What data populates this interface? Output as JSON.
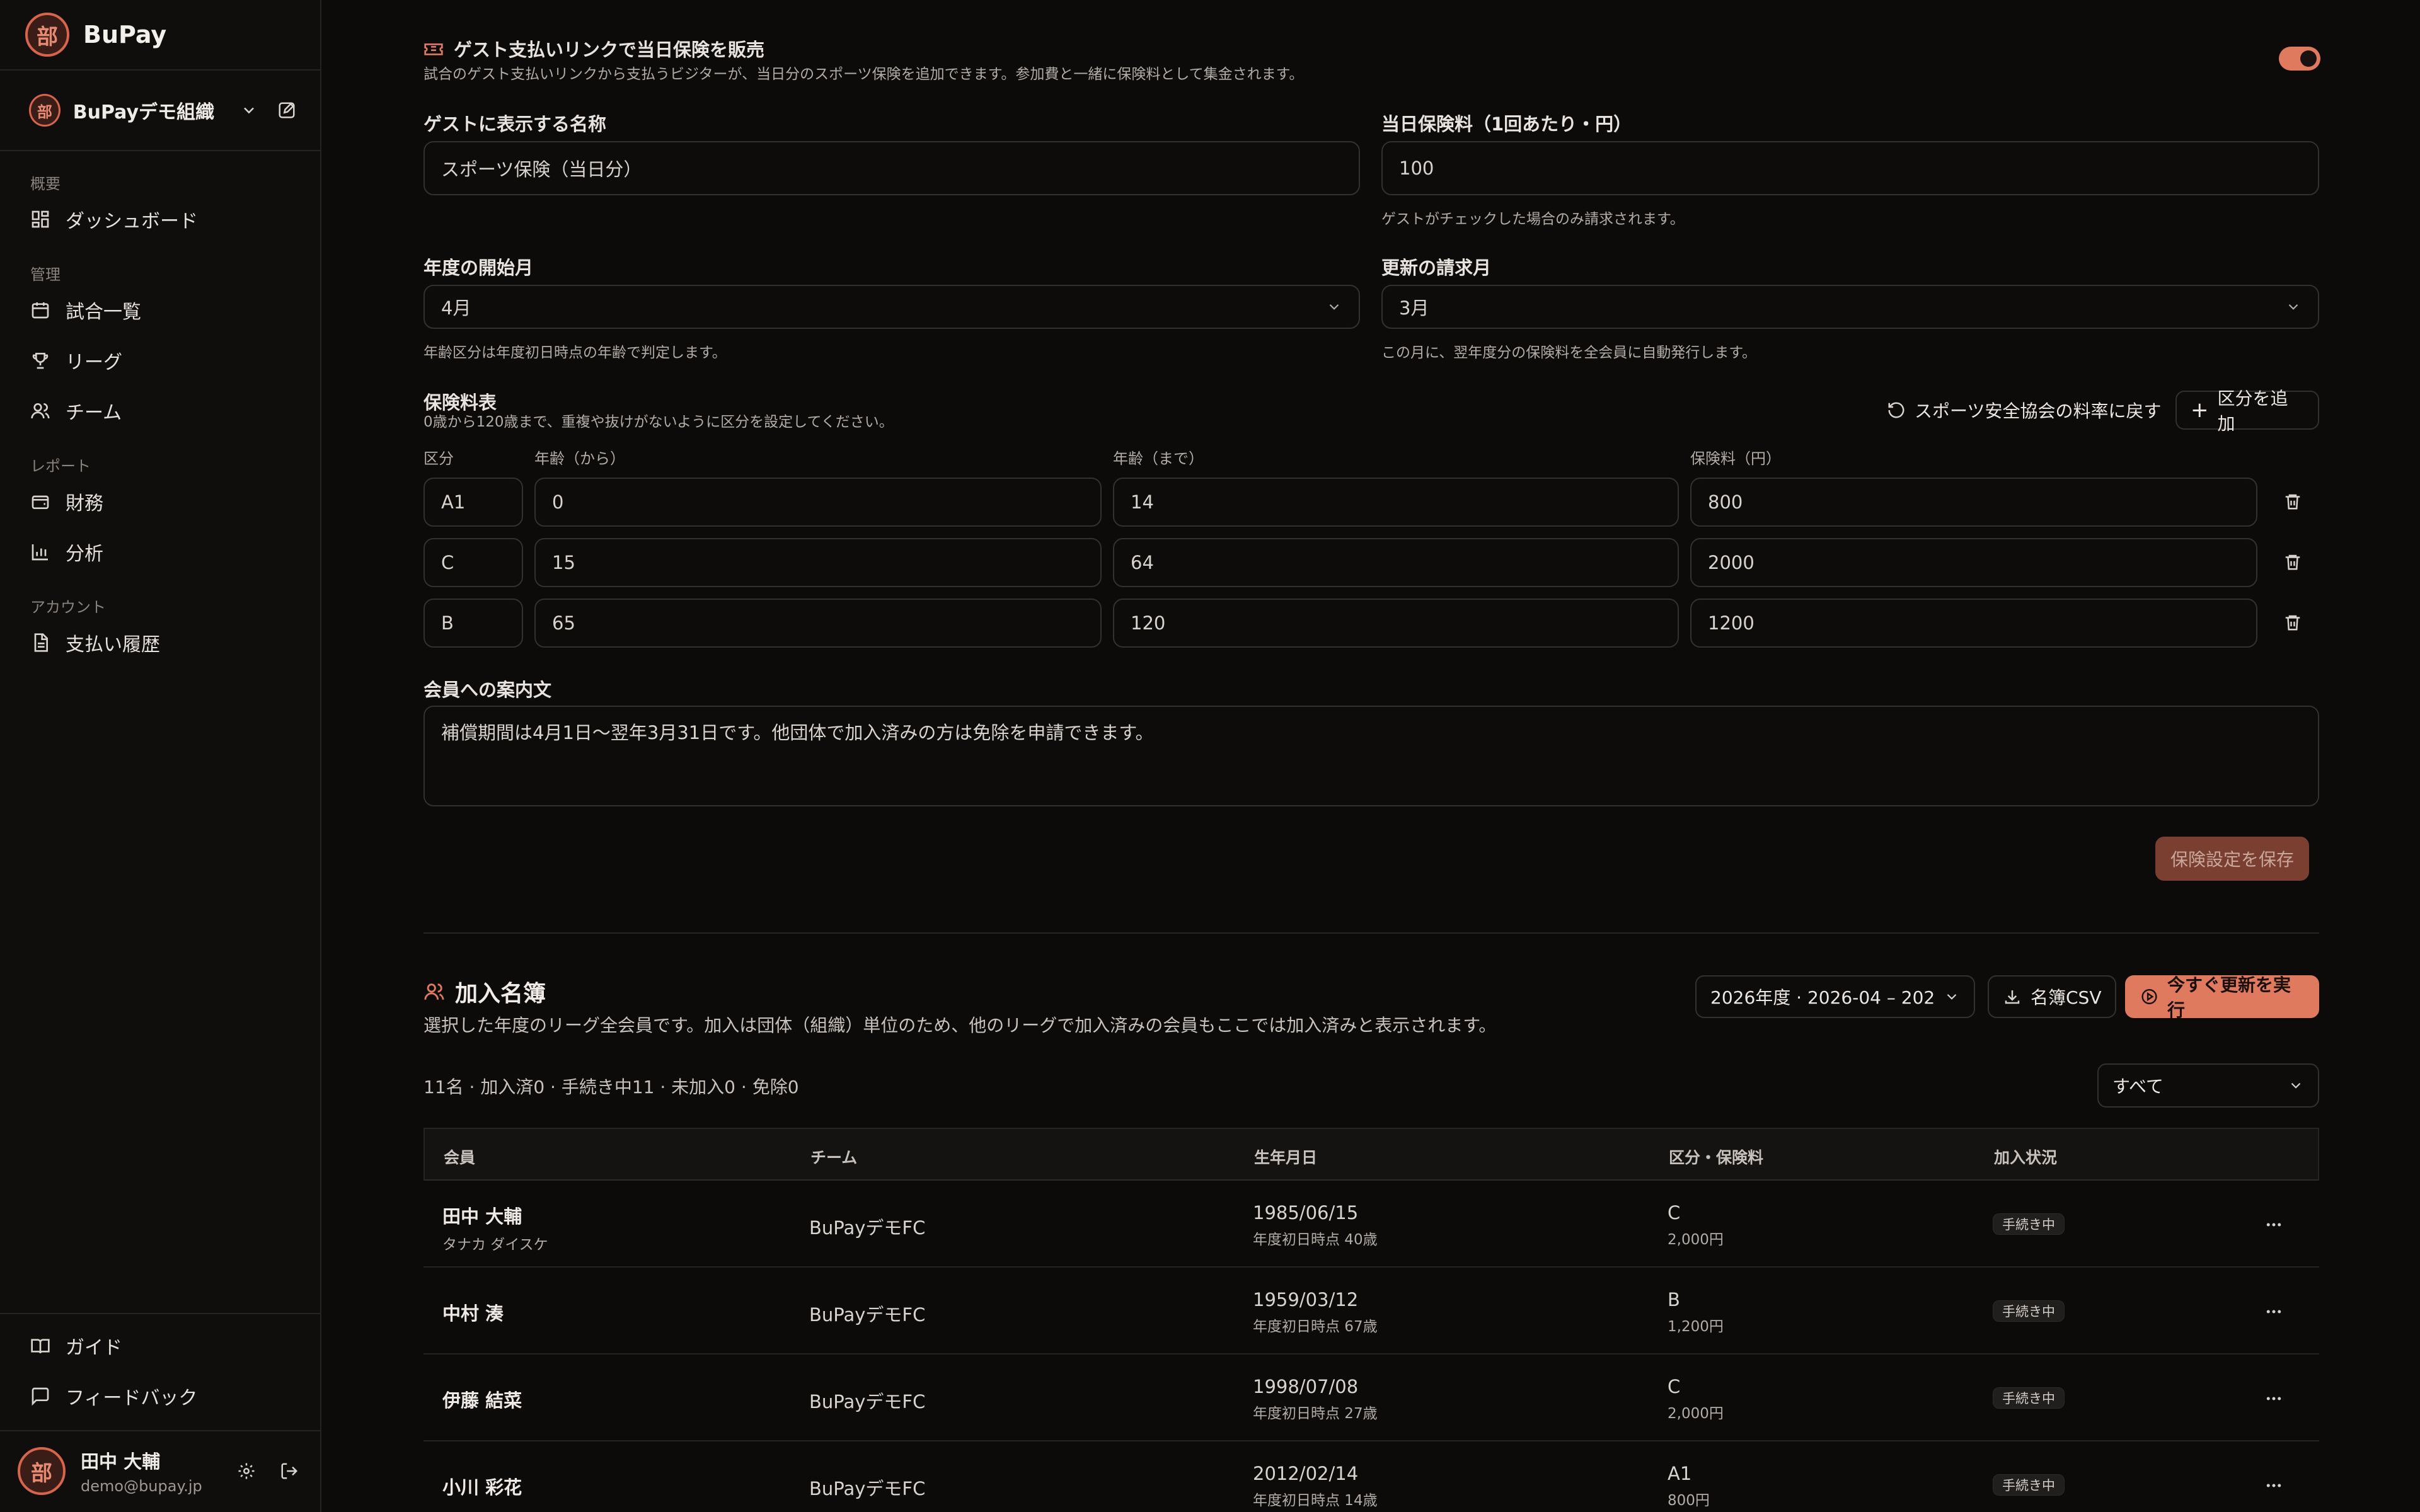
{
  "brand": {
    "logo_char": "部",
    "name": "BuPay"
  },
  "org": {
    "name": "BuPayデモ組織"
  },
  "nav": {
    "sections": [
      {
        "title": "概要",
        "items": [
          {
            "label": "ダッシュボード",
            "icon": "dashboard-icon"
          }
        ]
      },
      {
        "title": "管理",
        "items": [
          {
            "label": "試合一覧",
            "icon": "calendar-icon"
          },
          {
            "label": "リーグ",
            "icon": "trophy-icon"
          },
          {
            "label": "チーム",
            "icon": "users-icon"
          }
        ]
      },
      {
        "title": "レポート",
        "items": [
          {
            "label": "財務",
            "icon": "wallet-icon"
          },
          {
            "label": "分析",
            "icon": "bar-chart-icon"
          }
        ]
      },
      {
        "title": "アカウント",
        "items": [
          {
            "label": "支払い履歴",
            "icon": "document-icon"
          }
        ]
      }
    ],
    "footer": [
      {
        "label": "ガイド",
        "icon": "book-icon"
      },
      {
        "label": "フィードバック",
        "icon": "message-icon"
      }
    ]
  },
  "user": {
    "name": "田中 大輔",
    "email": "demo@bupay.jp"
  },
  "guest_insurance": {
    "title": "ゲスト支払いリンクで当日保険を販売",
    "description": "試合のゲスト支払いリンクから支払うビジターが、当日分のスポーツ保険を追加できます。参加費と一緒に保険料として集金されます。",
    "enabled": true,
    "display_name_label": "ゲストに表示する名称",
    "display_name_value": "スポーツ保険（当日分）",
    "fee_label": "当日保険料（1回あたり・円）",
    "fee_value": "100",
    "fee_help": "ゲストがチェックした場合のみ請求されます。"
  },
  "fiscal": {
    "start_label": "年度の開始月",
    "start_value": "4月",
    "start_help": "年齢区分は年度初日時点の年齢で判定します。",
    "renewal_label": "更新の請求月",
    "renewal_value": "3月",
    "renewal_help": "この月に、翌年度分の保険料を全会員に自動発行します。"
  },
  "rate_table": {
    "title": "保険料表",
    "help": "0歳から120歳まで、重複や抜けがないように区分を設定してください。",
    "reset_label": "スポーツ安全協会の料率に戻す",
    "add_label": "区分を追加",
    "headers": {
      "category": "区分",
      "age_from": "年齢（から）",
      "age_to": "年齢（まで）",
      "fee": "保険料（円）"
    },
    "rows": [
      {
        "category": "A1",
        "age_from": "0",
        "age_to": "14",
        "fee": "800"
      },
      {
        "category": "C",
        "age_from": "15",
        "age_to": "64",
        "fee": "2000"
      },
      {
        "category": "B",
        "age_from": "65",
        "age_to": "120",
        "fee": "1200"
      }
    ]
  },
  "notice": {
    "label": "会員への案内文",
    "value": "補償期間は4月1日〜翌年3月31日です。他団体で加入済みの方は免除を申請できます。"
  },
  "save_label": "保険設定を保存",
  "roster": {
    "title": "加入名簿",
    "description": "選択した年度のリーグ全会員です。加入は団体（組織）単位のため、他のリーグで加入済みの会員もここでは加入済みと表示されます。",
    "year_select": "2026年度 · 2026-04 – 202",
    "csv_label": "名簿CSV",
    "renew_label": "今すぐ更新を実行",
    "summary": "11名 · 加入済0 · 手続き中11 · 未加入0 · 免除0",
    "filter_value": "すべて",
    "columns": {
      "member": "会員",
      "team": "チーム",
      "birth": "生年月日",
      "category": "区分・保険料",
      "status": "加入状況"
    },
    "members": [
      {
        "name": "田中 大輔",
        "kana": "タナカ ダイスケ",
        "team": "BuPayデモFC",
        "birth": "1985/06/15",
        "age": "年度初日時点 40歳",
        "category": "C",
        "fee": "2,000円",
        "status": "手続き中"
      },
      {
        "name": "中村 湊",
        "kana": "",
        "team": "BuPayデモFC",
        "birth": "1959/03/12",
        "age": "年度初日時点 67歳",
        "category": "B",
        "fee": "1,200円",
        "status": "手続き中"
      },
      {
        "name": "伊藤 結菜",
        "kana": "",
        "team": "BuPayデモFC",
        "birth": "1998/07/08",
        "age": "年度初日時点 27歳",
        "category": "C",
        "fee": "2,000円",
        "status": "手続き中"
      },
      {
        "name": "小川 彩花",
        "kana": "",
        "team": "BuPayデモFC",
        "birth": "2012/02/14",
        "age": "年度初日時点 14歳",
        "category": "A1",
        "fee": "800円",
        "status": "手続き中"
      }
    ]
  },
  "colors": {
    "accent": "#e07a5f",
    "background": "#0c0b0a",
    "sidebar": "#0f0e0d",
    "border": "#34302d"
  }
}
